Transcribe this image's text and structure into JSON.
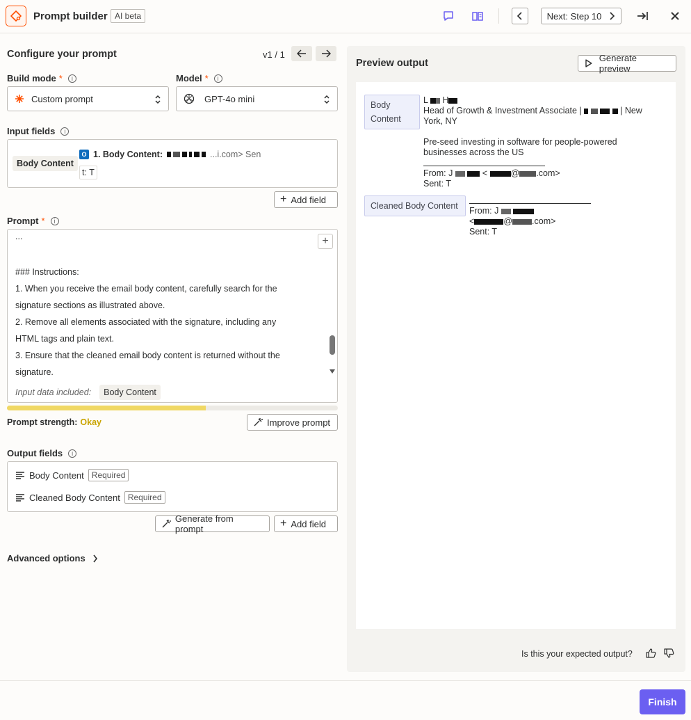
{
  "header": {
    "title": "Prompt builder",
    "beta_badge": "AI beta",
    "next_step_label": "Next: Step 10",
    "icons": [
      "sparkle-icon",
      "comment-icon",
      "book-icon",
      "chevron-left-icon",
      "chevron-right-icon",
      "collapse-arrow-icon",
      "close-icon"
    ]
  },
  "configure": {
    "title": "Configure your prompt",
    "version": "v1 / 1"
  },
  "build_mode": {
    "label": "Build mode",
    "required_mark": "*",
    "value": "Custom prompt"
  },
  "model": {
    "label": "Model",
    "required_mark": "*",
    "value": "GPT-4o mini"
  },
  "input_fields": {
    "label": "Input fields",
    "chip": "Body Content",
    "mapping_label": "1. Body Content:",
    "mapping_value": "...i.com>  Sen",
    "mapping_tail": "t: T",
    "add_field": "Add field"
  },
  "prompt": {
    "label": "Prompt",
    "required_mark": "*",
    "lines": [
      "...",
      "### Instructions:",
      "1. When you receive the email body content, carefully search for the",
      "signature sections as illustrated above.",
      "2. Remove all elements associated with the signature, including any",
      "HTML tags and plain text.",
      "3. Ensure that the cleaned email body content is returned without the",
      "signature."
    ],
    "input_data_label": "Input data included:",
    "input_data_chip": "Body Content",
    "strength_label": "Prompt strength:",
    "strength_value": "Okay",
    "strength_fraction": 0.6,
    "improve_label": "Improve prompt"
  },
  "output_fields": {
    "label": "Output fields",
    "items": [
      {
        "name": "Body Content",
        "tag": "Required"
      },
      {
        "name": "Cleaned Body Content",
        "tag": "Required"
      }
    ],
    "generate_label": "Generate from prompt",
    "add_field": "Add field"
  },
  "advanced": {
    "label": "Advanced options"
  },
  "preview": {
    "title": "Preview output",
    "generate_label": "Generate preview",
    "body_tag": "Body Content",
    "body_lines": {
      "name": "L",
      "title_line": "Head of Growth & Investment Associate |",
      "title_tail": "| New",
      "location": "York, NY",
      "tagline": "Pre-seed investing in software for people-powered businesses across the US",
      "from": "From: J",
      "from_tail": ".com>",
      "sent": "Sent: T"
    },
    "cleaned_tag": "Cleaned Body Content",
    "cleaned_lines": {
      "from": "From: J",
      "email_start": "<",
      "email_end": ".com>",
      "sent": "Sent: T"
    },
    "feedback_question": "Is this your expected output?"
  },
  "footer": {
    "finish_label": "Finish"
  },
  "colors": {
    "accent": "#ff4f00",
    "primary_button": "#6b5ff1",
    "strength_fill": "#f0d864",
    "strength_text": "#c9a400"
  }
}
